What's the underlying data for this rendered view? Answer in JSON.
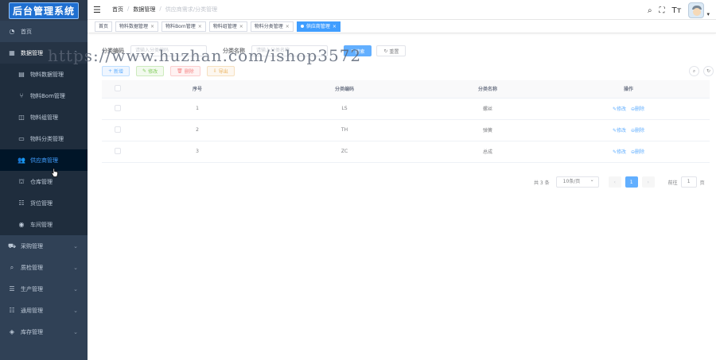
{
  "app": {
    "title": "后台管理系统"
  },
  "sidebar": {
    "items": [
      {
        "label": "首页",
        "icon": "dashboard-icon",
        "glyph": "◔"
      },
      {
        "label": "数据管理",
        "icon": "grid-icon",
        "glyph": "▦"
      },
      {
        "label": "采购管理",
        "icon": "cart-icon",
        "glyph": "🛒"
      },
      {
        "label": "质检管理",
        "icon": "search-icon",
        "glyph": "⌕"
      },
      {
        "label": "生产管理",
        "icon": "list-icon",
        "glyph": "☰"
      },
      {
        "label": "通用管理",
        "icon": "list-indent-icon",
        "glyph": "☷"
      },
      {
        "label": "库存管理",
        "icon": "cube-icon",
        "glyph": "◈"
      }
    ],
    "subitems": [
      {
        "label": "物料数据管理",
        "icon": "document-icon",
        "glyph": "▤"
      },
      {
        "label": "物料Bom管理",
        "icon": "tree-icon",
        "glyph": "⑂"
      },
      {
        "label": "物料组管理",
        "icon": "columns-icon",
        "glyph": "◫"
      },
      {
        "label": "物料分类管理",
        "icon": "rectangle-icon",
        "glyph": "▭"
      },
      {
        "label": "供应商管理",
        "icon": "users-icon",
        "glyph": "👥"
      },
      {
        "label": "仓库管理",
        "icon": "warehouse-icon",
        "glyph": "⛫"
      },
      {
        "label": "货位管理",
        "icon": "list-check-icon",
        "glyph": "☷"
      },
      {
        "label": "车间管理",
        "icon": "target-icon",
        "glyph": "◉"
      }
    ]
  },
  "breadcrumb": {
    "home": "首页",
    "level2": "数据管理",
    "current": "供应商需求/分类管理"
  },
  "tags": [
    {
      "label": "首页",
      "active": false
    },
    {
      "label": "物料数据管理",
      "active": false
    },
    {
      "label": "物料Bom管理",
      "active": false
    },
    {
      "label": "物料组管理",
      "active": false
    },
    {
      "label": "物料分类管理",
      "active": false
    },
    {
      "label": "供应商管理",
      "active": true
    }
  ],
  "search": {
    "code_label": "分类编码",
    "code_placeholder": "请输入分类编码",
    "name_label": "分类名称",
    "name_placeholder": "请输入分类名称",
    "search_btn": "搜索",
    "reset_btn": "重置"
  },
  "toolbar": {
    "add": "新增",
    "edit": "修改",
    "delete": "删除",
    "export": "导出"
  },
  "table": {
    "headers": [
      "序号",
      "分类编码",
      "分类名称",
      "操作"
    ],
    "rows": [
      {
        "no": "1",
        "code": "LS",
        "name": "螺丝"
      },
      {
        "no": "2",
        "code": "TH",
        "name": "弹簧"
      },
      {
        "no": "3",
        "code": "ZC",
        "name": "总成"
      }
    ],
    "op_edit": "修改",
    "op_delete": "删除"
  },
  "pagination": {
    "total": "共 3 条",
    "page_size": "10条/页",
    "current": "1",
    "goto_label": "前往",
    "goto_value": "1",
    "page_suffix": "页"
  },
  "watermark": "https://www.huzhan.com/ishop3572",
  "colors": {
    "sidebar": "#304156",
    "accent": "#409eff"
  }
}
